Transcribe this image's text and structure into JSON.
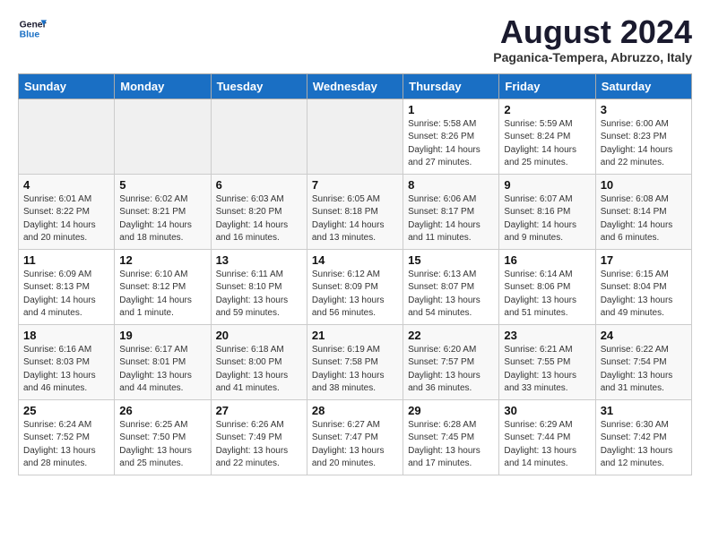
{
  "logo": {
    "line1": "General",
    "line2": "Blue"
  },
  "title": "August 2024",
  "subtitle": "Paganica-Tempera, Abruzzo, Italy",
  "days_of_week": [
    "Sunday",
    "Monday",
    "Tuesday",
    "Wednesday",
    "Thursday",
    "Friday",
    "Saturday"
  ],
  "weeks": [
    [
      {
        "day": "",
        "info": ""
      },
      {
        "day": "",
        "info": ""
      },
      {
        "day": "",
        "info": ""
      },
      {
        "day": "",
        "info": ""
      },
      {
        "day": "1",
        "info": "Sunrise: 5:58 AM\nSunset: 8:26 PM\nDaylight: 14 hours\nand 27 minutes."
      },
      {
        "day": "2",
        "info": "Sunrise: 5:59 AM\nSunset: 8:24 PM\nDaylight: 14 hours\nand 25 minutes."
      },
      {
        "day": "3",
        "info": "Sunrise: 6:00 AM\nSunset: 8:23 PM\nDaylight: 14 hours\nand 22 minutes."
      }
    ],
    [
      {
        "day": "4",
        "info": "Sunrise: 6:01 AM\nSunset: 8:22 PM\nDaylight: 14 hours\nand 20 minutes."
      },
      {
        "day": "5",
        "info": "Sunrise: 6:02 AM\nSunset: 8:21 PM\nDaylight: 14 hours\nand 18 minutes."
      },
      {
        "day": "6",
        "info": "Sunrise: 6:03 AM\nSunset: 8:20 PM\nDaylight: 14 hours\nand 16 minutes."
      },
      {
        "day": "7",
        "info": "Sunrise: 6:05 AM\nSunset: 8:18 PM\nDaylight: 14 hours\nand 13 minutes."
      },
      {
        "day": "8",
        "info": "Sunrise: 6:06 AM\nSunset: 8:17 PM\nDaylight: 14 hours\nand 11 minutes."
      },
      {
        "day": "9",
        "info": "Sunrise: 6:07 AM\nSunset: 8:16 PM\nDaylight: 14 hours\nand 9 minutes."
      },
      {
        "day": "10",
        "info": "Sunrise: 6:08 AM\nSunset: 8:14 PM\nDaylight: 14 hours\nand 6 minutes."
      }
    ],
    [
      {
        "day": "11",
        "info": "Sunrise: 6:09 AM\nSunset: 8:13 PM\nDaylight: 14 hours\nand 4 minutes."
      },
      {
        "day": "12",
        "info": "Sunrise: 6:10 AM\nSunset: 8:12 PM\nDaylight: 14 hours\nand 1 minute."
      },
      {
        "day": "13",
        "info": "Sunrise: 6:11 AM\nSunset: 8:10 PM\nDaylight: 13 hours\nand 59 minutes."
      },
      {
        "day": "14",
        "info": "Sunrise: 6:12 AM\nSunset: 8:09 PM\nDaylight: 13 hours\nand 56 minutes."
      },
      {
        "day": "15",
        "info": "Sunrise: 6:13 AM\nSunset: 8:07 PM\nDaylight: 13 hours\nand 54 minutes."
      },
      {
        "day": "16",
        "info": "Sunrise: 6:14 AM\nSunset: 8:06 PM\nDaylight: 13 hours\nand 51 minutes."
      },
      {
        "day": "17",
        "info": "Sunrise: 6:15 AM\nSunset: 8:04 PM\nDaylight: 13 hours\nand 49 minutes."
      }
    ],
    [
      {
        "day": "18",
        "info": "Sunrise: 6:16 AM\nSunset: 8:03 PM\nDaylight: 13 hours\nand 46 minutes."
      },
      {
        "day": "19",
        "info": "Sunrise: 6:17 AM\nSunset: 8:01 PM\nDaylight: 13 hours\nand 44 minutes."
      },
      {
        "day": "20",
        "info": "Sunrise: 6:18 AM\nSunset: 8:00 PM\nDaylight: 13 hours\nand 41 minutes."
      },
      {
        "day": "21",
        "info": "Sunrise: 6:19 AM\nSunset: 7:58 PM\nDaylight: 13 hours\nand 38 minutes."
      },
      {
        "day": "22",
        "info": "Sunrise: 6:20 AM\nSunset: 7:57 PM\nDaylight: 13 hours\nand 36 minutes."
      },
      {
        "day": "23",
        "info": "Sunrise: 6:21 AM\nSunset: 7:55 PM\nDaylight: 13 hours\nand 33 minutes."
      },
      {
        "day": "24",
        "info": "Sunrise: 6:22 AM\nSunset: 7:54 PM\nDaylight: 13 hours\nand 31 minutes."
      }
    ],
    [
      {
        "day": "25",
        "info": "Sunrise: 6:24 AM\nSunset: 7:52 PM\nDaylight: 13 hours\nand 28 minutes."
      },
      {
        "day": "26",
        "info": "Sunrise: 6:25 AM\nSunset: 7:50 PM\nDaylight: 13 hours\nand 25 minutes."
      },
      {
        "day": "27",
        "info": "Sunrise: 6:26 AM\nSunset: 7:49 PM\nDaylight: 13 hours\nand 22 minutes."
      },
      {
        "day": "28",
        "info": "Sunrise: 6:27 AM\nSunset: 7:47 PM\nDaylight: 13 hours\nand 20 minutes."
      },
      {
        "day": "29",
        "info": "Sunrise: 6:28 AM\nSunset: 7:45 PM\nDaylight: 13 hours\nand 17 minutes."
      },
      {
        "day": "30",
        "info": "Sunrise: 6:29 AM\nSunset: 7:44 PM\nDaylight: 13 hours\nand 14 minutes."
      },
      {
        "day": "31",
        "info": "Sunrise: 6:30 AM\nSunset: 7:42 PM\nDaylight: 13 hours\nand 12 minutes."
      }
    ]
  ]
}
